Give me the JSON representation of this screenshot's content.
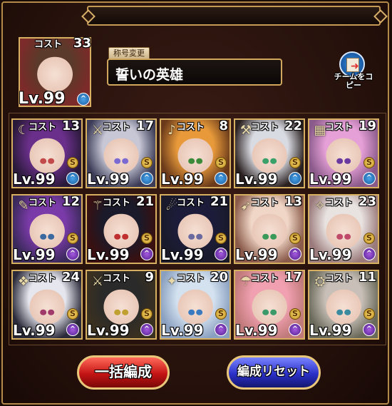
{
  "leader": {
    "cost_label": "コスト",
    "cost": "33",
    "level": "Lv.99",
    "rank_mark": "^",
    "colors": {
      "bg": "#7d2a2a",
      "hair": "#5a3a2a",
      "eye": "#b03030"
    }
  },
  "title": {
    "tag": "称号変更",
    "text": "誓いの英雄"
  },
  "copy_button": {
    "label": "チームをコピー"
  },
  "units": [
    {
      "cost": "13",
      "rank": "S",
      "rank_color": "blue",
      "hair": "#6a2f8a",
      "bg": "#2a1a3a",
      "eye": "#c24a4a"
    },
    {
      "cost": "17",
      "rank": "S",
      "rank_color": "blue",
      "hair": "#c7c7d6",
      "bg": "#3c3c58",
      "eye": "#7a6ad2"
    },
    {
      "cost": "8",
      "rank": "S",
      "rank_color": "blue",
      "hair": "#e89a3a",
      "bg": "#6a3a1a",
      "eye": "#3a8a3a"
    },
    {
      "cost": "22",
      "rank": "S",
      "rank_color": "blue",
      "hair": "#d9dbe2",
      "bg": "#2a2020",
      "eye": "#3aa06a"
    },
    {
      "cost": "19",
      "rank": "S",
      "rank_color": "blue",
      "hair": "#e6a0d8",
      "bg": "#8a5a8a",
      "eye": "#6a3aa0"
    },
    {
      "cost": "12",
      "rank": "S",
      "rank_color": "purple",
      "hair": "#7a3aa8",
      "bg": "#3a2a5a",
      "eye": "#3a6aa0"
    },
    {
      "cost": "21",
      "rank": "S",
      "rank_color": "purple",
      "hair": "#1a1a2a",
      "bg": "#3a1010",
      "eye": "#c03030"
    },
    {
      "cost": "21",
      "rank": "S",
      "rank_color": "purple",
      "hair": "#1c1c3a",
      "bg": "#1a1a2a",
      "eye": "#6a6aa0"
    },
    {
      "cost": "13",
      "rank": "S",
      "rank_color": "purple",
      "hair": "#f0d6c6",
      "bg": "#8a5a4a",
      "eye": "#3a9a5a"
    },
    {
      "cost": "23",
      "rank": "S",
      "rank_color": "purple",
      "hair": "#e8e2e0",
      "bg": "#9a7a7a",
      "eye": "#c04a6a"
    },
    {
      "cost": "24",
      "rank": "S",
      "rank_color": "purple",
      "hair": "#e6e6ee",
      "bg": "#2a2a3a",
      "eye": "#a03a6a"
    },
    {
      "cost": "9",
      "rank": "S",
      "rank_color": "purple",
      "hair": "#2a2a2a",
      "bg": "#3a3020",
      "eye": "#c0a030"
    },
    {
      "cost": "20",
      "rank": "S",
      "rank_color": "purple",
      "hair": "#d4e2f0",
      "bg": "#8aa0c0",
      "eye": "#3a7ac0"
    },
    {
      "cost": "17",
      "rank": "S",
      "rank_color": "purple",
      "hair": "#f0a0b0",
      "bg": "#c07a7a",
      "eye": "#3a9a6a"
    },
    {
      "cost": "11",
      "rank": "S",
      "rank_color": "purple",
      "hair": "#c8c0b8",
      "bg": "#6a6a5a",
      "eye": "#3a8aa0"
    }
  ],
  "unit_cost_label": "コスト",
  "unit_level": "Lv.99",
  "rank_mark": "^",
  "weapon_icons": [
    "☾",
    "⚔",
    "♪",
    "⚒",
    "▦",
    "✎",
    "⚚",
    "☄",
    "➹",
    "✧",
    "❖",
    "⚔",
    "✦",
    "☂",
    "⛭"
  ],
  "buttons": {
    "bulk": "一括編成",
    "reset": "編成リセット"
  }
}
